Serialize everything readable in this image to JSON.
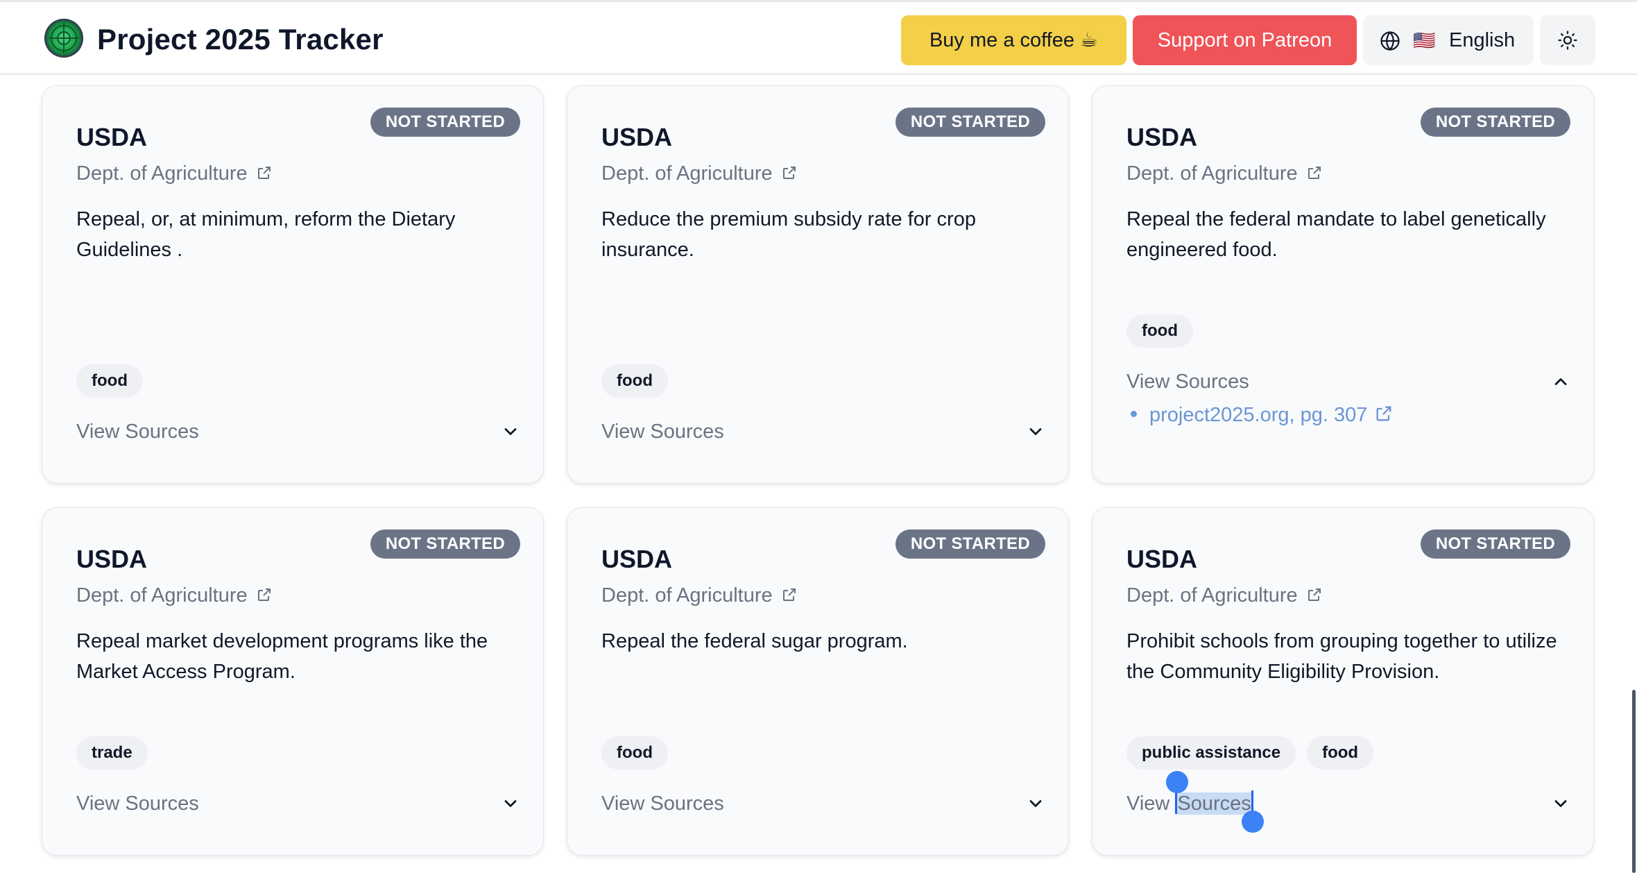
{
  "header": {
    "title": "Project 2025 Tracker",
    "coffee_label": "Buy me a coffee ☕",
    "patreon_label": "Support on Patreon",
    "language_flag": "🇺🇸",
    "language_label": "English"
  },
  "colors": {
    "coffee": "#f4cf48",
    "patreon": "#ef5459",
    "badge": "#6b7487",
    "link": "#6b95d4",
    "card_bg": "#f8fafc"
  },
  "cards": [
    {
      "agency": "USDA",
      "status": "NOT STARTED",
      "department": "Dept. of Agriculture",
      "description": "Repeal, or, at minimum, reform the Dietary Guidelines .",
      "tags": [
        "food"
      ],
      "view_sources": "View Sources"
    },
    {
      "agency": "USDA",
      "status": "NOT STARTED",
      "department": "Dept. of Agriculture",
      "description": "Reduce the premium subsidy rate for crop insurance.",
      "tags": [
        "food"
      ],
      "view_sources": "View Sources"
    },
    {
      "agency": "USDA",
      "status": "NOT STARTED",
      "department": "Dept. of Agriculture",
      "description": "Repeal the federal mandate to label genetically engineered food.",
      "tags": [
        "food"
      ],
      "view_sources": "View Sources",
      "sources": [
        "project2025.org, pg. 307"
      ]
    },
    {
      "agency": "USDA",
      "status": "NOT STARTED",
      "department": "Dept. of Agriculture",
      "description": "Repeal market development programs like the Market Access Program.",
      "tags": [
        "trade"
      ],
      "view_sources": "View Sources"
    },
    {
      "agency": "USDA",
      "status": "NOT STARTED",
      "department": "Dept. of Agriculture",
      "description": "Repeal the federal sugar program.",
      "tags": [
        "food"
      ],
      "view_sources": "View Sources"
    },
    {
      "agency": "USDA",
      "status": "NOT STARTED",
      "department": "Dept. of Agriculture",
      "description": "Prohibit schools from grouping together to utilize the Community Eligibility Provision.",
      "tags": [
        "public assistance",
        "food"
      ],
      "view_sources_first": "View ",
      "view_sources_selected": "Sources"
    }
  ]
}
